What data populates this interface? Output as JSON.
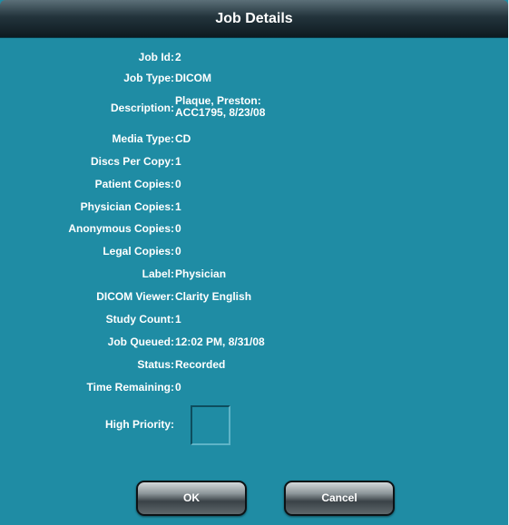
{
  "window": {
    "title": "Job Details"
  },
  "fields": [
    {
      "label": "Job Id:",
      "value": "2"
    },
    {
      "label": "Job Type:",
      "value": "DICOM"
    },
    {
      "label": "Description:",
      "value_line1": "Plaque, Preston:",
      "value_line2": "ACC1795, 8/23/08"
    },
    {
      "label": "Media Type:",
      "value": "CD"
    },
    {
      "label": "Discs Per Copy:",
      "value": "1"
    },
    {
      "label": "Patient Copies:",
      "value": "0"
    },
    {
      "label": "Physician Copies:",
      "value": "1"
    },
    {
      "label": "Anonymous Copies:",
      "value": "0"
    },
    {
      "label": "Legal Copies:",
      "value": "0"
    },
    {
      "label": "Label:",
      "value": "Physician"
    },
    {
      "label": "DICOM Viewer:",
      "value": "Clarity English"
    },
    {
      "label": "Study Count:",
      "value": "1"
    },
    {
      "label": "Job Queued:",
      "value": "12:02 PM, 8/31/08"
    },
    {
      "label": "Status:",
      "value": "Recorded"
    },
    {
      "label": "Time Remaining:",
      "value": "0"
    }
  ],
  "high_priority": {
    "label": "High Priority:",
    "checked": false
  },
  "buttons": {
    "ok_label": "OK",
    "cancel_label": "Cancel"
  },
  "colors": {
    "panel_background": "#1f8ca4",
    "title_bar": "#1a2a32",
    "text": "#ffffff"
  }
}
